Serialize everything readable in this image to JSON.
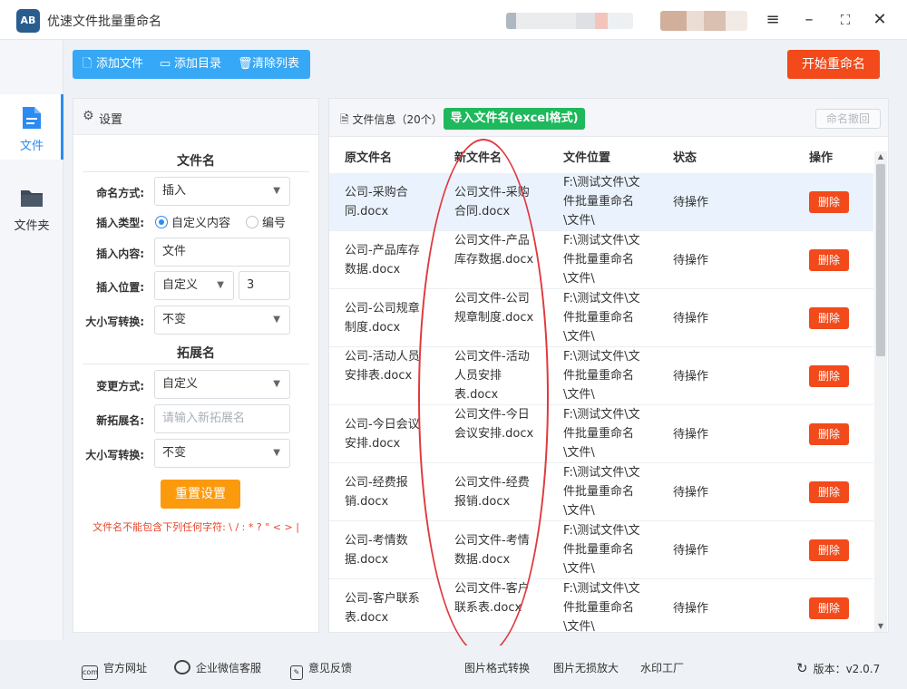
{
  "app": {
    "title": "优速文件批量重命名",
    "logo_text": "AB"
  },
  "nav": [
    {
      "label": "文件",
      "active": true
    },
    {
      "label": "文件夹",
      "active": false
    }
  ],
  "toolbar": {
    "add_file": "添加文件",
    "add_dir": "添加目录",
    "clear_list": "清除列表",
    "start": "开始重命名"
  },
  "settings": {
    "header": "设置",
    "filename_section": "文件名",
    "naming_mode_label": "命名方式:",
    "naming_mode_value": "插入",
    "insert_type_label": "插入类型:",
    "insert_type_options": [
      "自定义内容",
      "编号"
    ],
    "insert_type_selected": "自定义内容",
    "insert_content_label": "插入内容:",
    "insert_content_value": "文件",
    "insert_position_label": "插入位置:",
    "insert_position_value": "自定义",
    "insert_position_number": "3",
    "case_label": "大小写转换:",
    "case_value": "不变",
    "ext_section": "拓展名",
    "change_mode_label": "变更方式:",
    "change_mode_value": "自定义",
    "new_ext_label": "新拓展名:",
    "new_ext_placeholder": "请输入新拓展名",
    "ext_case_label": "大小写转换:",
    "ext_case_value": "不变",
    "reset": "重置设置",
    "warning": "文件名不能包含下列任何字符: \\ / : * ? \" < > |"
  },
  "files": {
    "header": "文件信息（20个）",
    "import_button": "导入文件名(excel格式)",
    "undo_button": "命名撤回",
    "columns": [
      "原文件名",
      "新文件名",
      "文件位置",
      "状态",
      "操作"
    ],
    "rows": [
      {
        "orig": "公司-采购合同.docx",
        "new": "公司文件-采购合同.docx",
        "loc": "F:\\测试文件\\文件批量重命名\\文件\\",
        "status": "待操作",
        "action": "删除"
      },
      {
        "orig": "公司-产品库存数据.docx",
        "new": "公司文件-产品库存数据.docx",
        "loc": "F:\\测试文件\\文件批量重命名\\文件\\",
        "status": "待操作",
        "action": "删除"
      },
      {
        "orig": "公司-公司规章制度.docx",
        "new": "公司文件-公司规章制度.docx",
        "loc": "F:\\测试文件\\文件批量重命名\\文件\\",
        "status": "待操作",
        "action": "删除"
      },
      {
        "orig": "公司-活动人员安排表.docx",
        "new": "公司文件-活动人员安排表.docx",
        "loc": "F:\\测试文件\\文件批量重命名\\文件\\",
        "status": "待操作",
        "action": "删除"
      },
      {
        "orig": "公司-今日会议安排.docx",
        "new": "公司文件-今日会议安排.docx",
        "loc": "F:\\测试文件\\文件批量重命名\\文件\\",
        "status": "待操作",
        "action": "删除"
      },
      {
        "orig": "公司-经费报销.docx",
        "new": "公司文件-经费报销.docx",
        "loc": "F:\\测试文件\\文件批量重命名\\文件\\",
        "status": "待操作",
        "action": "删除"
      },
      {
        "orig": "公司-考情数据.docx",
        "new": "公司文件-考情数据.docx",
        "loc": "F:\\测试文件\\文件批量重命名\\文件\\",
        "status": "待操作",
        "action": "删除"
      },
      {
        "orig": "公司-客户联系表.docx",
        "new": "公司文件-客户联系表.docx",
        "loc": "F:\\测试文件\\文件批量重命名\\文件\\",
        "status": "待操作",
        "action": "删除"
      }
    ]
  },
  "footer": {
    "website": "官方网址",
    "wechat": "企业微信客服",
    "feedback": "意见反馈",
    "img_convert": "图片格式转换",
    "img_enlarge": "图片无损放大",
    "watermark": "水印工厂",
    "version": "版本：v2.0.7"
  },
  "colors": {
    "accent": "#37a8f5",
    "primary_action": "#f24a1a",
    "import": "#1fb85c",
    "reset": "#fb9a0c",
    "annotation": "#e0393e"
  }
}
